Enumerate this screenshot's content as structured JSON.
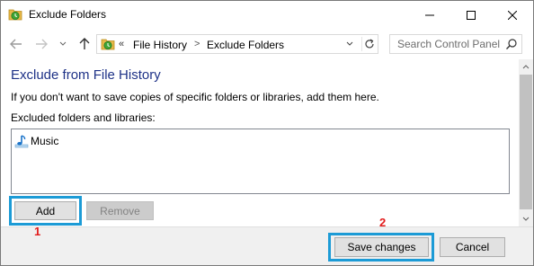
{
  "window": {
    "title": "Exclude Folders"
  },
  "address_bar": {
    "chevron": "«",
    "crumbs": [
      "File History",
      "Exclude Folders"
    ],
    "separator": ">"
  },
  "search": {
    "placeholder": "Search Control Panel"
  },
  "main": {
    "heading": "Exclude from File History",
    "description": "If you don't want to save copies of specific folders or libraries, add them here.",
    "list_label": "Excluded folders and libraries:",
    "excluded_items": [
      {
        "label": "Music",
        "icon": "music-library-icon"
      }
    ],
    "add_label": "Add",
    "remove_label": "Remove"
  },
  "footer": {
    "save_label": "Save changes",
    "cancel_label": "Cancel"
  },
  "annotations": {
    "marker_1": "1",
    "marker_2": "2"
  },
  "colors": {
    "heading": "#1e3287",
    "highlight": "#1c9bd6",
    "marker": "#e21c1c"
  }
}
